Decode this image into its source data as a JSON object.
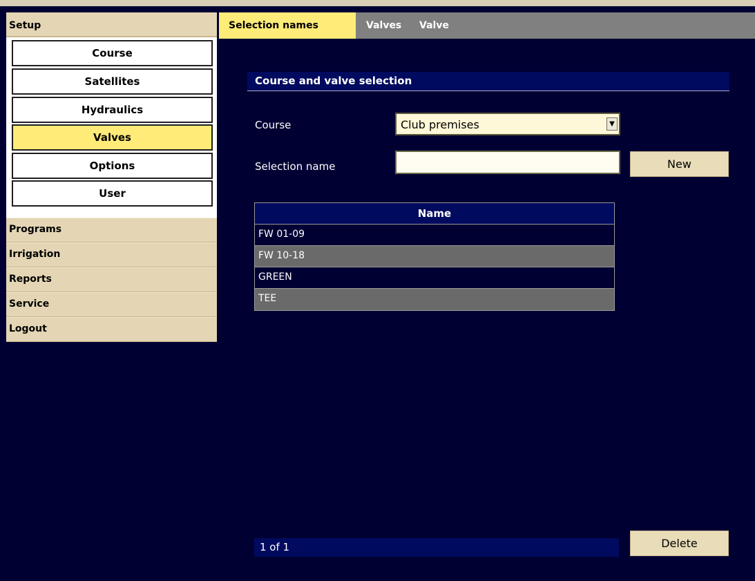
{
  "sidebar": {
    "header": "Setup",
    "sub_items": [
      {
        "label": "Course",
        "active": false
      },
      {
        "label": "Satellites",
        "active": false
      },
      {
        "label": "Hydraulics",
        "active": false
      },
      {
        "label": "Valves",
        "active": true
      },
      {
        "label": "Options",
        "active": false
      },
      {
        "label": "User",
        "active": false
      }
    ],
    "main_items": [
      {
        "label": "Programs"
      },
      {
        "label": "Irrigation"
      },
      {
        "label": "Reports"
      },
      {
        "label": "Service"
      },
      {
        "label": "Logout"
      }
    ]
  },
  "tabs": [
    {
      "label": "Selection names",
      "active": true
    },
    {
      "label": "Valves",
      "active": false
    },
    {
      "label": "Valve",
      "active": false
    }
  ],
  "section": {
    "title": "Course and valve selection"
  },
  "form": {
    "course_label": "Course",
    "course_value": "Club premises",
    "selection_name_label": "Selection name",
    "selection_name_value": "",
    "new_button": "New"
  },
  "table": {
    "header": "Name",
    "rows": [
      "FW 01-09",
      "FW 10-18",
      "GREEN",
      "TEE"
    ]
  },
  "pager": {
    "text": "1 of 1"
  },
  "delete_button": "Delete",
  "colors": {
    "background": "#000033",
    "highlight": "#ffeb77",
    "menu": "#e4d6b4",
    "header_blue": "#000a5e"
  }
}
